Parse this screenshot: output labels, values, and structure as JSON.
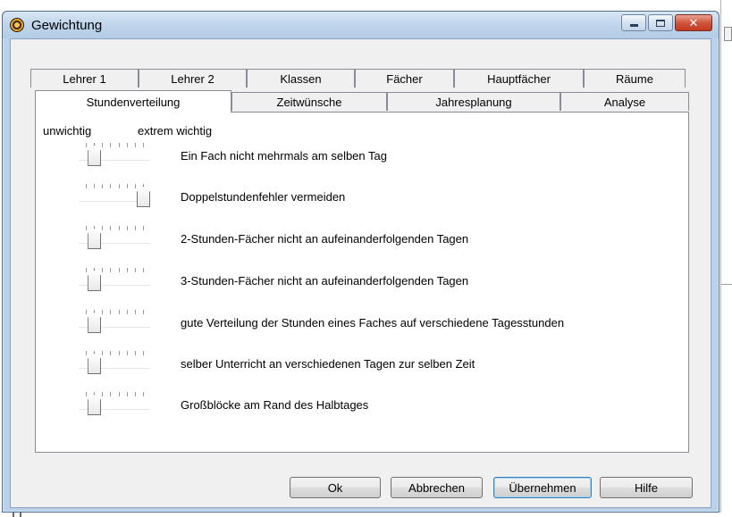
{
  "window": {
    "title": "Gewichtung",
    "close_glyph": "✕"
  },
  "tabs_row1": [
    {
      "label": "Lehrer 1"
    },
    {
      "label": "Lehrer 2"
    },
    {
      "label": "Klassen"
    },
    {
      "label": "Fächer"
    },
    {
      "label": "Hauptfächer"
    },
    {
      "label": "Räume"
    }
  ],
  "tabs_row2": [
    {
      "label": "Stundenverteilung",
      "active": true
    },
    {
      "label": "Zeitwünsche"
    },
    {
      "label": "Jahresplanung"
    },
    {
      "label": "Analyse"
    }
  ],
  "scale": {
    "min_label": "unwichtig",
    "max_label": "extrem wichtig",
    "steps": 8
  },
  "options": [
    {
      "label": "Ein Fach nicht mehrmals am selben Tag",
      "level": 1
    },
    {
      "label": "Doppelstundenfehler vermeiden",
      "level": 7
    },
    {
      "label": "2-Stunden-Fächer nicht an aufeinanderfolgenden Tagen",
      "level": 1
    },
    {
      "label": "3-Stunden-Fächer nicht an aufeinanderfolgenden Tagen",
      "level": 1
    },
    {
      "label": "gute Verteilung der Stunden eines Faches auf verschiedene Tagesstunden",
      "level": 1
    },
    {
      "label": "selber Unterricht an verschiedenen Tagen zur selben Zeit",
      "level": 1
    },
    {
      "label": "Großblöcke am Rand des Halbtages",
      "level": 1
    }
  ],
  "buttons": {
    "ok": "Ok",
    "cancel": "Abbrechen",
    "apply": "Übernehmen",
    "help": "Hilfe"
  }
}
